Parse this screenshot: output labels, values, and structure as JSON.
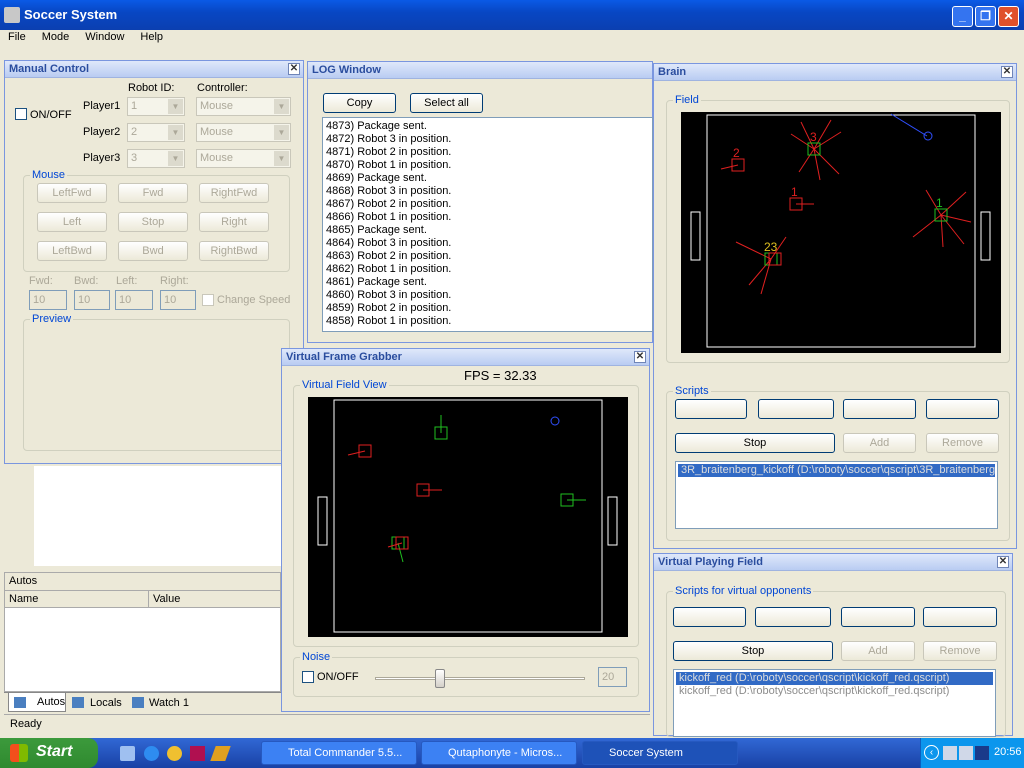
{
  "app": {
    "title": "Soccer System",
    "min": "_",
    "max": "❐",
    "close": "✕"
  },
  "menu": [
    "File",
    "Mode",
    "Window",
    "Help"
  ],
  "manual": {
    "title": "Manual Control",
    "onoff": "ON/OFF",
    "robot_id": "Robot ID:",
    "controller": "Controller:",
    "players": [
      {
        "name": "Player1",
        "id": "1",
        "ctrl": "Mouse"
      },
      {
        "name": "Player2",
        "id": "2",
        "ctrl": "Mouse"
      },
      {
        "name": "Player3",
        "id": "3",
        "ctrl": "Mouse"
      }
    ],
    "mouse_group": "Mouse",
    "buttons": [
      "LeftFwd",
      "Fwd",
      "RightFwd",
      "Left",
      "Stop",
      "Right",
      "LeftBwd",
      "Bwd",
      "RightBwd"
    ],
    "speeds": [
      {
        "label": "Fwd:",
        "value": "10"
      },
      {
        "label": "Bwd:",
        "value": "10"
      },
      {
        "label": "Left:",
        "value": "10"
      },
      {
        "label": "Right:",
        "value": "10"
      }
    ],
    "change_speed": "Change Speed",
    "preview": "Preview"
  },
  "debug": {
    "autos": "Autos",
    "col_name": "Name",
    "col_value": "Value",
    "tabs": [
      "Autos",
      "Locals",
      "Watch 1"
    ],
    "status": "Ready"
  },
  "log": {
    "title": "LOG Window",
    "copy": "Copy",
    "select_all": "Select all",
    "lines": [
      "4873) Package sent.",
      "4872) Robot 3 in position.",
      "4871) Robot 2 in position.",
      "4870) Robot 1 in position.",
      "4869) Package sent.",
      "4868) Robot 3 in position.",
      "4867) Robot 2 in position.",
      "4866) Robot 1 in position.",
      "4865) Package sent.",
      "4864) Robot 3 in position.",
      "4863) Robot 2 in position.",
      "4862) Robot 1 in position.",
      "4861) Package sent.",
      "4860) Robot 3 in position.",
      "4859) Robot 2 in position.",
      "4858) Robot 1 in position."
    ]
  },
  "brain": {
    "title": "Brain",
    "field": "Field",
    "scripts": "Scripts",
    "stop": "Stop",
    "add": "Add",
    "remove": "Remove",
    "script_items": [
      "3R_braitenberg_kickoff (D:\\roboty\\soccer\\qscript\\3R_braitenberg_"
    ],
    "robot_labels": [
      "3",
      "2",
      "1",
      "1",
      "23"
    ]
  },
  "grabber": {
    "title": "Virtual Frame Grabber",
    "fps": "FPS = 32.33",
    "view": "Virtual Field View",
    "noise": "Noise",
    "onoff": "ON/OFF",
    "noise_value": "20",
    "noise_level": 0.3
  },
  "vpf": {
    "title": "Virtual Playing Field",
    "scripts": "Scripts for virtual opponents",
    "stop": "Stop",
    "add": "Add",
    "remove": "Remove",
    "script_items": [
      "kickoff_red (D:\\roboty\\soccer\\qscript\\kickoff_red.qscript)",
      "kickoff_red (D:\\roboty\\soccer\\qscript\\kickoff_red.qscript)"
    ]
  },
  "taskbar": {
    "start": "Start",
    "tasks": [
      "Total Commander 5.5...",
      "Qutaphonyte - Micros...",
      "Soccer System"
    ],
    "clock": "20:56"
  },
  "colors": {
    "red": "#e02020",
    "green": "#20c020",
    "blue": "#3050ff"
  }
}
